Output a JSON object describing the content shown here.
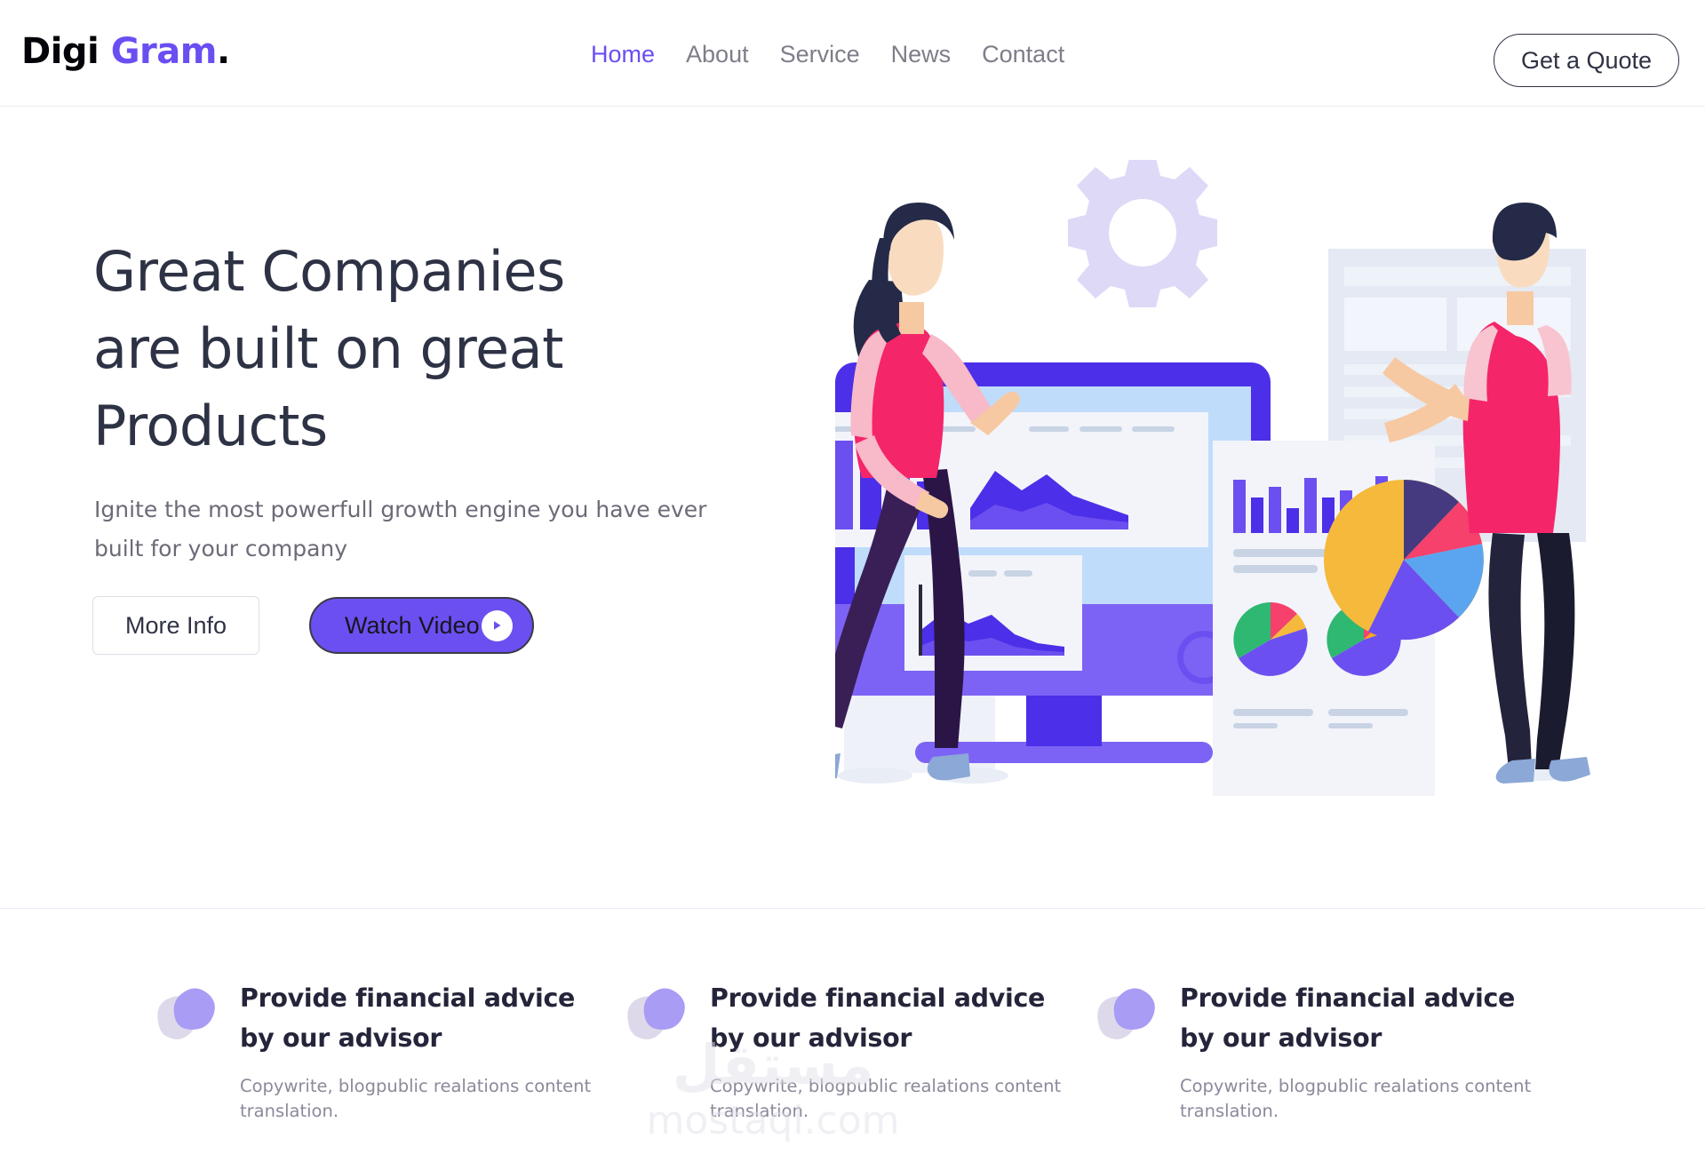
{
  "brand": {
    "word1": "Digi",
    "word2": "Gram",
    "dot": ".",
    "color_primary": "#6b4ef2",
    "color_dark": "#05030a"
  },
  "nav": {
    "items": [
      {
        "label": "Home",
        "active": true
      },
      {
        "label": "About",
        "active": false
      },
      {
        "label": "Service",
        "active": false
      },
      {
        "label": "News",
        "active": false
      },
      {
        "label": "Contact",
        "active": false
      }
    ],
    "cta_label": "Get a Quote"
  },
  "hero": {
    "title_line1": "Great Companies",
    "title_line2": "are built on great",
    "title_line3": "Products",
    "subtitle": "Ignite the most powerfull growth engine you have ever built for your company",
    "button_secondary": "More Info",
    "button_primary": "Watch Video",
    "play_icon": "play-icon",
    "illustration_name": "data-analytics-illustration"
  },
  "features": [
    {
      "icon": "blob-icon",
      "title": "Provide financial advice by our advisor",
      "desc": "Copywrite, blogpublic realations content translation."
    },
    {
      "icon": "blob-icon",
      "title": "Provide financial advice by our advisor",
      "desc": "Copywrite, blogpublic realations content translation."
    },
    {
      "icon": "blob-icon",
      "title": "Provide financial advice by our advisor",
      "desc": "Copywrite, blogpublic realations content translation."
    }
  ],
  "watermark": {
    "line1": "مستقل",
    "line2": "mostaql.com"
  },
  "colors": {
    "accent_purple": "#6c4ff0",
    "deep_purple": "#4c2fe8",
    "light_purple": "#7d63f5",
    "blob_purple": "#a89cf5",
    "blob_lavender": "#ddd9ea",
    "heading": "#2e3245",
    "body_text": "#6b6b78",
    "muted": "#8a8a9b",
    "screen_blue": "#bfdcfb",
    "gear_lavender": "#ddd9f7",
    "gear_gray": "#d5dde8",
    "shirt_red": "#f5256a",
    "skin": "#f7c9a2",
    "pie_green": "#2eb872",
    "pie_yellow": "#f5b93b",
    "pie_navy": "#453a80"
  }
}
